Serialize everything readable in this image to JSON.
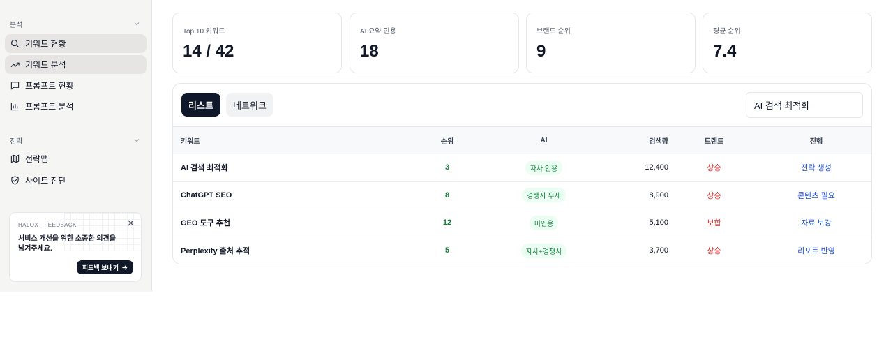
{
  "sidebar": {
    "sections": [
      {
        "title": "분석",
        "items": [
          {
            "label": "키워드 현황",
            "icon": "search-icon"
          },
          {
            "label": "키워드 분석",
            "icon": "trending-up-icon"
          },
          {
            "label": "프롬프트 현황",
            "icon": "chat-icon"
          },
          {
            "label": "프롬프트 분석",
            "icon": "bar-chart-icon"
          }
        ]
      },
      {
        "title": "전략",
        "items": [
          {
            "label": "전략맵",
            "icon": "map-icon"
          },
          {
            "label": "사이트 진단",
            "icon": "shield-check-icon"
          }
        ]
      }
    ],
    "feedback": {
      "title": "HALOX · FEEDBACK",
      "text": "서비스 개선을 위한 소중한 의견을 남겨주세요.",
      "button": "피드백 보내기"
    }
  },
  "stats": [
    {
      "label": "Top 10 키워드",
      "value": "14 / 42"
    },
    {
      "label": "AI 요약 인용",
      "value": "18"
    },
    {
      "label": "브랜드 순위",
      "value": "9"
    },
    {
      "label": "평균 순위",
      "value": "7.4"
    }
  ],
  "tabs": {
    "active": "리스트",
    "inactive": "네트워크"
  },
  "search": {
    "value": "AI 검색 최적화"
  },
  "table": {
    "headers": {
      "keyword": "키워드",
      "rank": "순위",
      "ai": "AI",
      "volume": "검색량",
      "trend": "트렌드",
      "progress": "진행"
    },
    "rows": [
      {
        "keyword": "AI 검색 최적화",
        "rank": "3",
        "ai": "자사 인용",
        "volume": "12,400",
        "trend": "상승",
        "progress": "전략 생성"
      },
      {
        "keyword": "ChatGPT SEO",
        "rank": "8",
        "ai": "경쟁사 우세",
        "volume": "8,900",
        "trend": "상승",
        "progress": "콘텐츠 필요"
      },
      {
        "keyword": "GEO 도구 추천",
        "rank": "12",
        "ai": "미인용",
        "volume": "5,100",
        "trend": "보합",
        "progress": "자료 보강"
      },
      {
        "keyword": "Perplexity 출처 추적",
        "rank": "5",
        "ai": "자사+경쟁사",
        "volume": "3,700",
        "trend": "상승",
        "progress": "리포트 반영"
      }
    ]
  },
  "colors": {
    "accent": "#0f172a",
    "positive": "#15803d",
    "trend": "#dc2626",
    "link": "#1d4ed8"
  }
}
